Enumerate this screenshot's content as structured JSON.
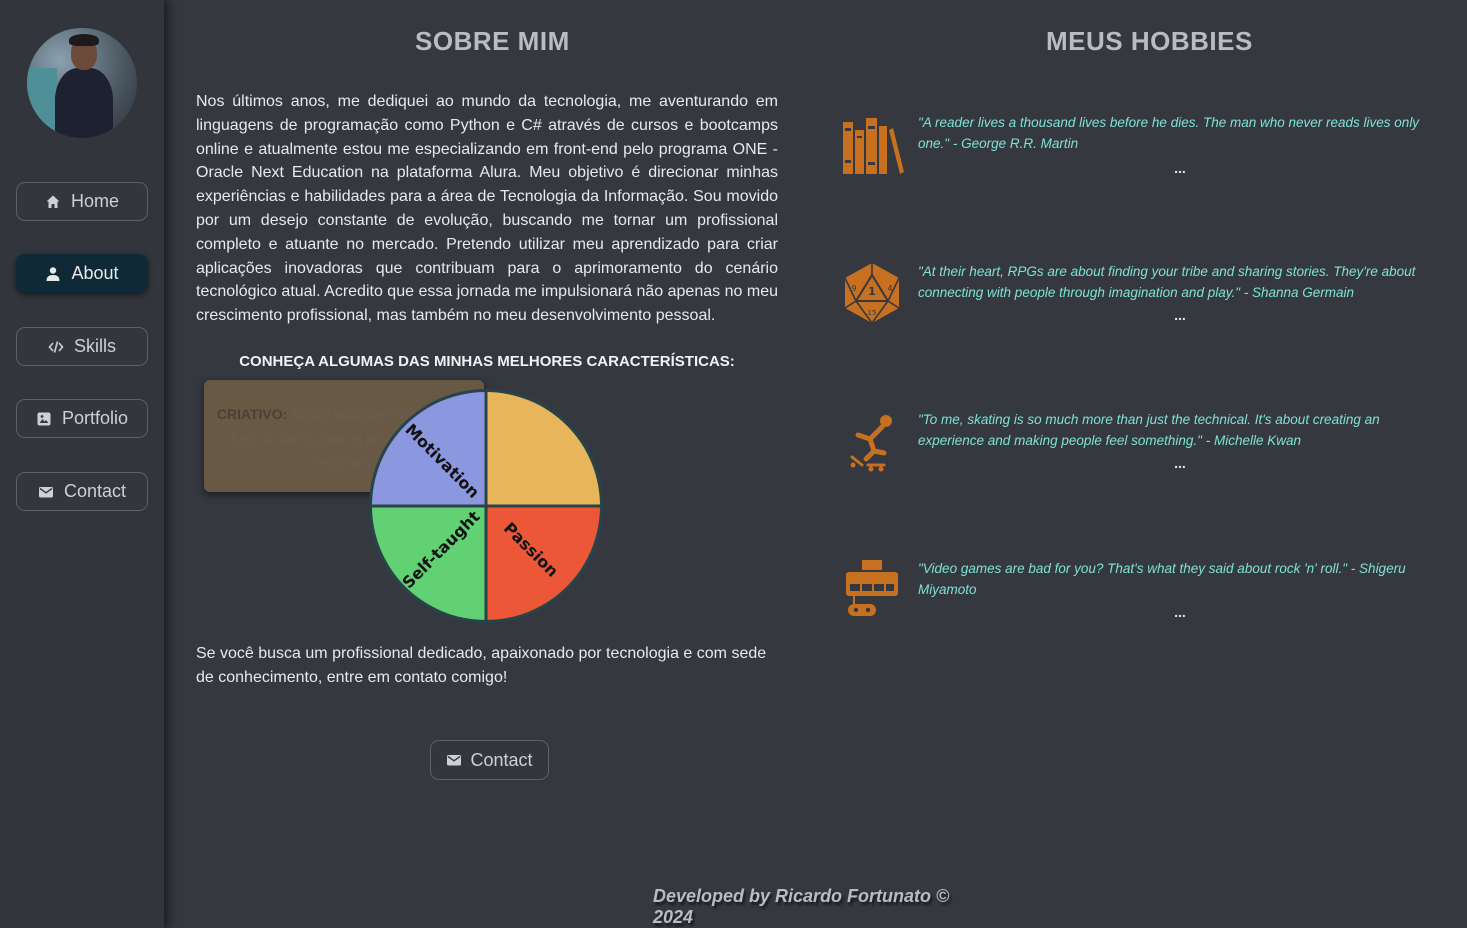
{
  "sidebar": {
    "items": [
      {
        "label": "Home",
        "icon": "home-icon"
      },
      {
        "label": "About",
        "icon": "user-icon",
        "active": true
      },
      {
        "label": "Skills",
        "icon": "code-icon"
      },
      {
        "label": "Portfolio",
        "icon": "image-icon"
      },
      {
        "label": "Contact",
        "icon": "mail-icon"
      }
    ]
  },
  "about": {
    "title": "SOBRE MIM",
    "paragraph": "Nos últimos anos, me dediquei ao mundo da tecnologia, me aventurando em linguagens de programação como Python e C# através de cursos e bootcamps online e atualmente estou me especializando em front-end pelo programa ONE - Oracle Next Education na plataforma Alura. Meu objetivo é direcionar minhas experiências e habilidades para a área de Tecnologia da Informação. Sou movido por um desejo constante de evolução, buscando me tornar um profissional completo e atuante no mercado. Pretendo utilizar meu aprendizado para criar aplicações inovadoras que contribuam para o aprimoramento do cenário tecnológico atual. Acredito que essa jornada me impulsionará não apenas no meu crescimento profissional, mas também no meu desenvolvimento pessoal.",
    "traits_heading": "CONHEÇA ALGUMAS DAS MINHAS MELHORES CARACTERÍSTICAS:",
    "tooltip_label": "CRIATIVO:",
    "tooltip_text": " Busco soluções inovadoras e fora da caixa para os problemas que encontro.",
    "closing": "Se você busca um profissional dedicado, apaixonado por tecnologia e com sede de conhecimento, entre em contato comigo!",
    "contact_label": "Contact"
  },
  "chart_data": {
    "type": "pie",
    "slices": [
      {
        "label": "",
        "value": 25,
        "color": "#e8b55a"
      },
      {
        "label": "Passion",
        "value": 25,
        "color": "#ec5738"
      },
      {
        "label": "Self-taught",
        "value": 25,
        "color": "#62d174"
      },
      {
        "label": "Motivation",
        "value": 25,
        "color": "#8b97de"
      }
    ]
  },
  "hobbies": {
    "title": "MEUS HOBBIES",
    "items": [
      {
        "icon": "books-icon",
        "quote": "\"A reader lives a thousand lives before he dies. The man who never reads lives only one.\" - George R.R. Martin",
        "more": "..."
      },
      {
        "icon": "d20-dice-icon",
        "quote": "\"At their heart, RPGs are about finding your tribe and sharing stories. They're about connecting with people through imagination and play.\" - Shanna Germain",
        "more": "..."
      },
      {
        "icon": "skater-icon",
        "quote": "\"To me, skating is so much more than just the technical. It's about creating an experience and making people feel something.\" - Michelle Kwan",
        "more": "..."
      },
      {
        "icon": "game-console-icon",
        "quote": "\"Video games are bad for you? That's what they said about rock 'n' roll.\" - Shigeru Miyamoto",
        "more": "..."
      }
    ]
  },
  "footer": {
    "text": "Developed by Ricardo Fortunato © 2024"
  },
  "colors": {
    "background": "#363840",
    "active_nav": "#0f2a36",
    "quote": "#7de3d6",
    "icon": "#c7701f"
  }
}
